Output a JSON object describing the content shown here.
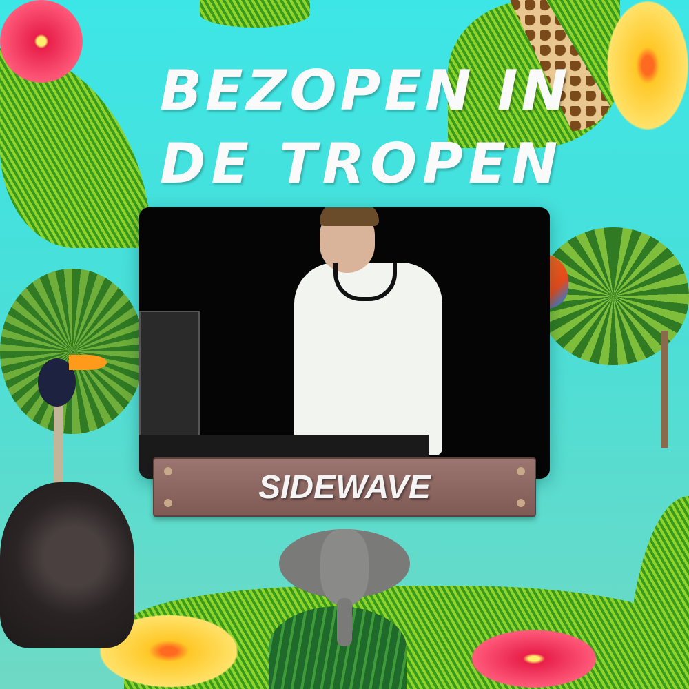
{
  "poster": {
    "title_line1": "BEZOPEN IN",
    "title_line2": "DE TROPEN",
    "artist_name": "SIDEWAVE"
  },
  "colors": {
    "background": "#3de6e6",
    "title_text": "#fafafa",
    "sign_wood": "#8f6a65"
  }
}
